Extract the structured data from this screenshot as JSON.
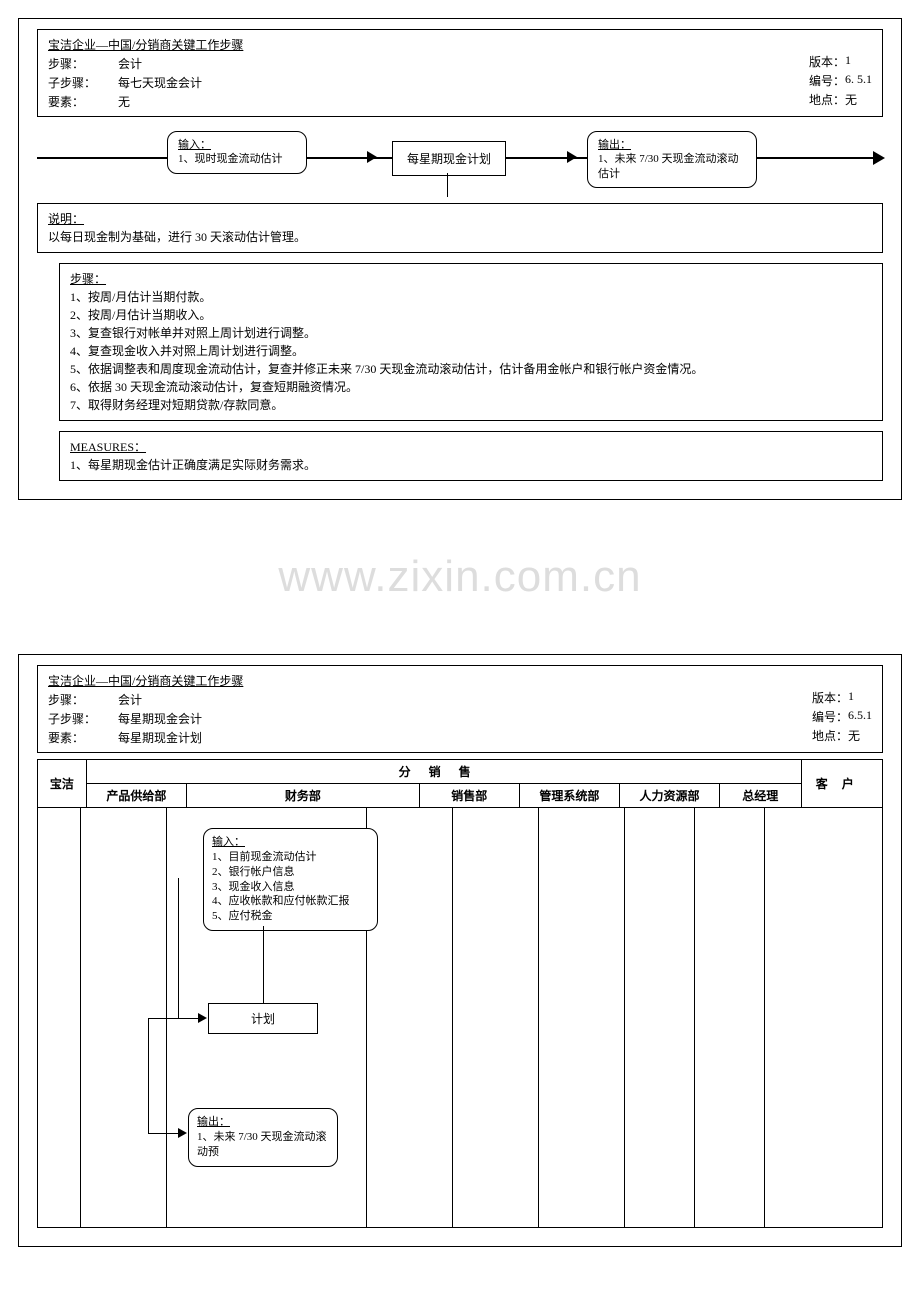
{
  "page1": {
    "header": {
      "title": "宝洁企业—中国/分销商关键工作步骤",
      "step_lbl": "步骤：",
      "step_val": "会计",
      "substep_lbl": "子步骤：",
      "substep_val": "每七天现金会计",
      "elem_lbl": "要素：",
      "elem_val": "无",
      "ver_lbl": "版本：",
      "ver_val": "1",
      "code_lbl": "编号：",
      "code_val": "6. 5.1",
      "loc_lbl": "地点：",
      "loc_val": "无"
    },
    "flow": {
      "in_lbl": "输入：",
      "in_1": "1、现时现金流动估计",
      "mid": "每星期现金计划",
      "out_lbl": "输出：",
      "out_1": "1、未来 7/30 天现金流动滚动估计"
    },
    "explain": {
      "title": "说明：",
      "body": "以每日现金制为基础，进行 30 天滚动估计管理。"
    },
    "steps": {
      "title": "步骤：",
      "items": [
        "1、按周/月估计当期付款。",
        "2、按周/月估计当期收入。",
        "3、复查银行对帐单并对照上周计划进行调整。",
        "4、复查现金收入并对照上周计划进行调整。",
        "5、依据调整表和周度现金流动估计，复查并修正未来 7/30 天现金流动滚动估计，估计备用金帐户和银行帐户资金情况。",
        "6、依据 30 天现金流动滚动估计，复查短期融资情况。",
        "7、取得财务经理对短期贷款/存款同意。"
      ]
    },
    "measures": {
      "title": "MEASURES：",
      "body": "1、每星期现金估计正确度满足实际财务需求。"
    }
  },
  "watermark": "www.zixin.com.cn",
  "page2": {
    "header": {
      "title": "宝洁企业—中国/分销商关键工作步骤",
      "step_lbl": "步骤：",
      "step_val": "会计",
      "substep_lbl": "子步骤：",
      "substep_val": "每星期现金会计",
      "elem_lbl": "要素：",
      "elem_val": "每星期现金计划",
      "ver_lbl": "版本：",
      "ver_val": "1",
      "code_lbl": "编号：",
      "code_val": "6.5.1",
      "loc_lbl": "地点：",
      "loc_val": "无"
    },
    "dept": {
      "baojie": "宝洁",
      "group": "分销售",
      "cols": [
        "产品供给部",
        "财务部",
        "销售部",
        "管理系统部",
        "人力资源部",
        "总经理"
      ],
      "cust": "客户"
    },
    "flow": {
      "in_lbl": "输入：",
      "in_items": [
        "1、目前现金流动估计",
        "2、银行帐户信息",
        "3、现金收入信息",
        "4、应收帐款和应付帐款汇报",
        "5、应付税金"
      ],
      "mid": "计划",
      "out_lbl": "输出：",
      "out_1": "1、未来 7/30 天现金流动滚动预"
    }
  }
}
